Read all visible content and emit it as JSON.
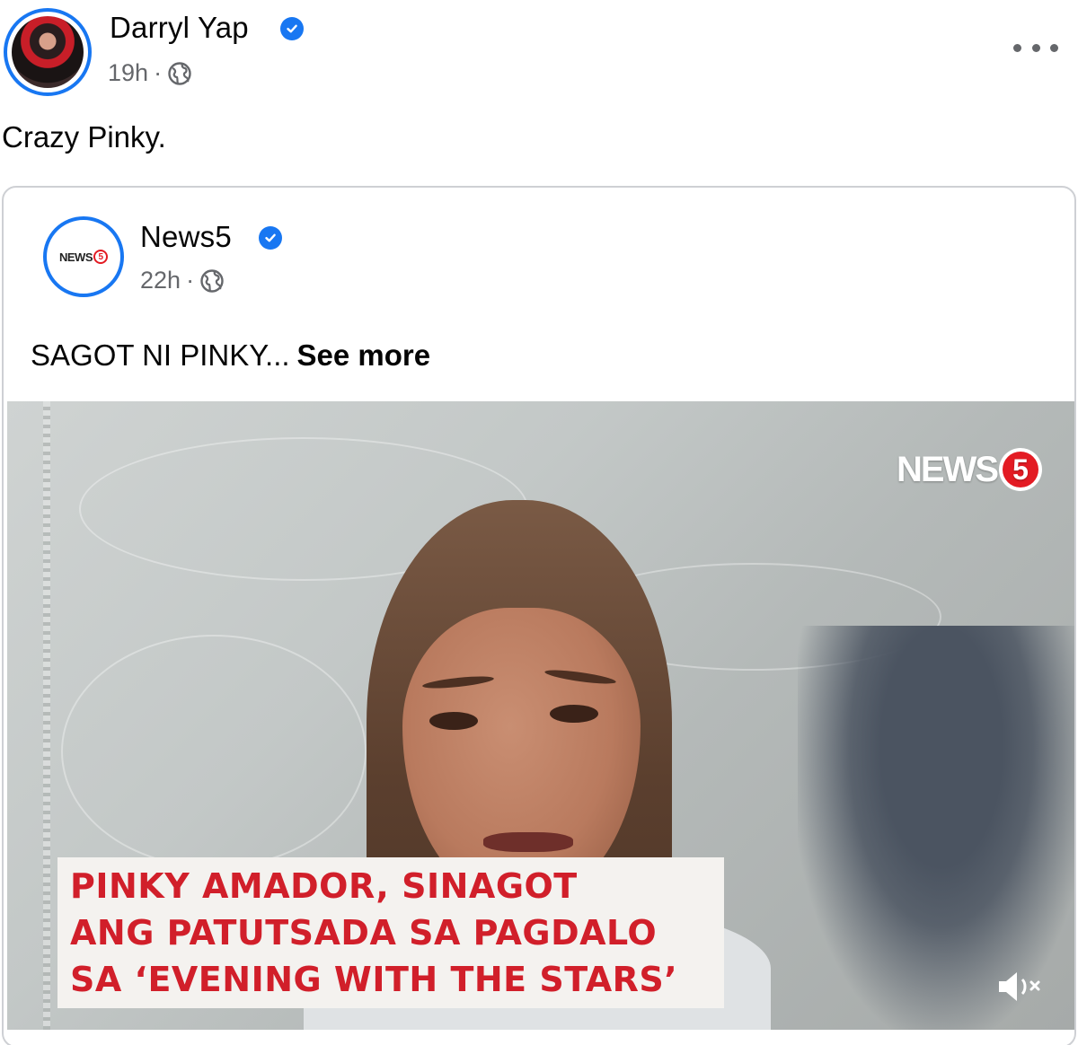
{
  "post": {
    "author": "Darryl Yap",
    "time": "19h",
    "separator": "·",
    "text": "Crazy Pinky."
  },
  "shared": {
    "author": "News5",
    "time": "22h",
    "separator": "·",
    "avatar_text": "NEWS",
    "avatar_five": "5",
    "caption": "SAGOT NI PINKY...",
    "see_more": "See more",
    "video": {
      "logo_text": "NEWS",
      "logo_five": "5",
      "headline": [
        "PINKY AMADOR, SINAGOT",
        "ANG PATUTSADA SA PAGDALO",
        "SA ‘EVENING WITH THE STARS’"
      ],
      "audio_state": "muted"
    }
  },
  "icons": {
    "verified": "verified-badge-icon",
    "privacy": "globe-icon",
    "menu": "more-dots-icon",
    "mute": "muted-speaker-icon"
  },
  "colors": {
    "accent": "#1877f2",
    "secondary_text": "#65676b",
    "headline_red": "#d11f2a",
    "news5_red": "#e31b23"
  }
}
